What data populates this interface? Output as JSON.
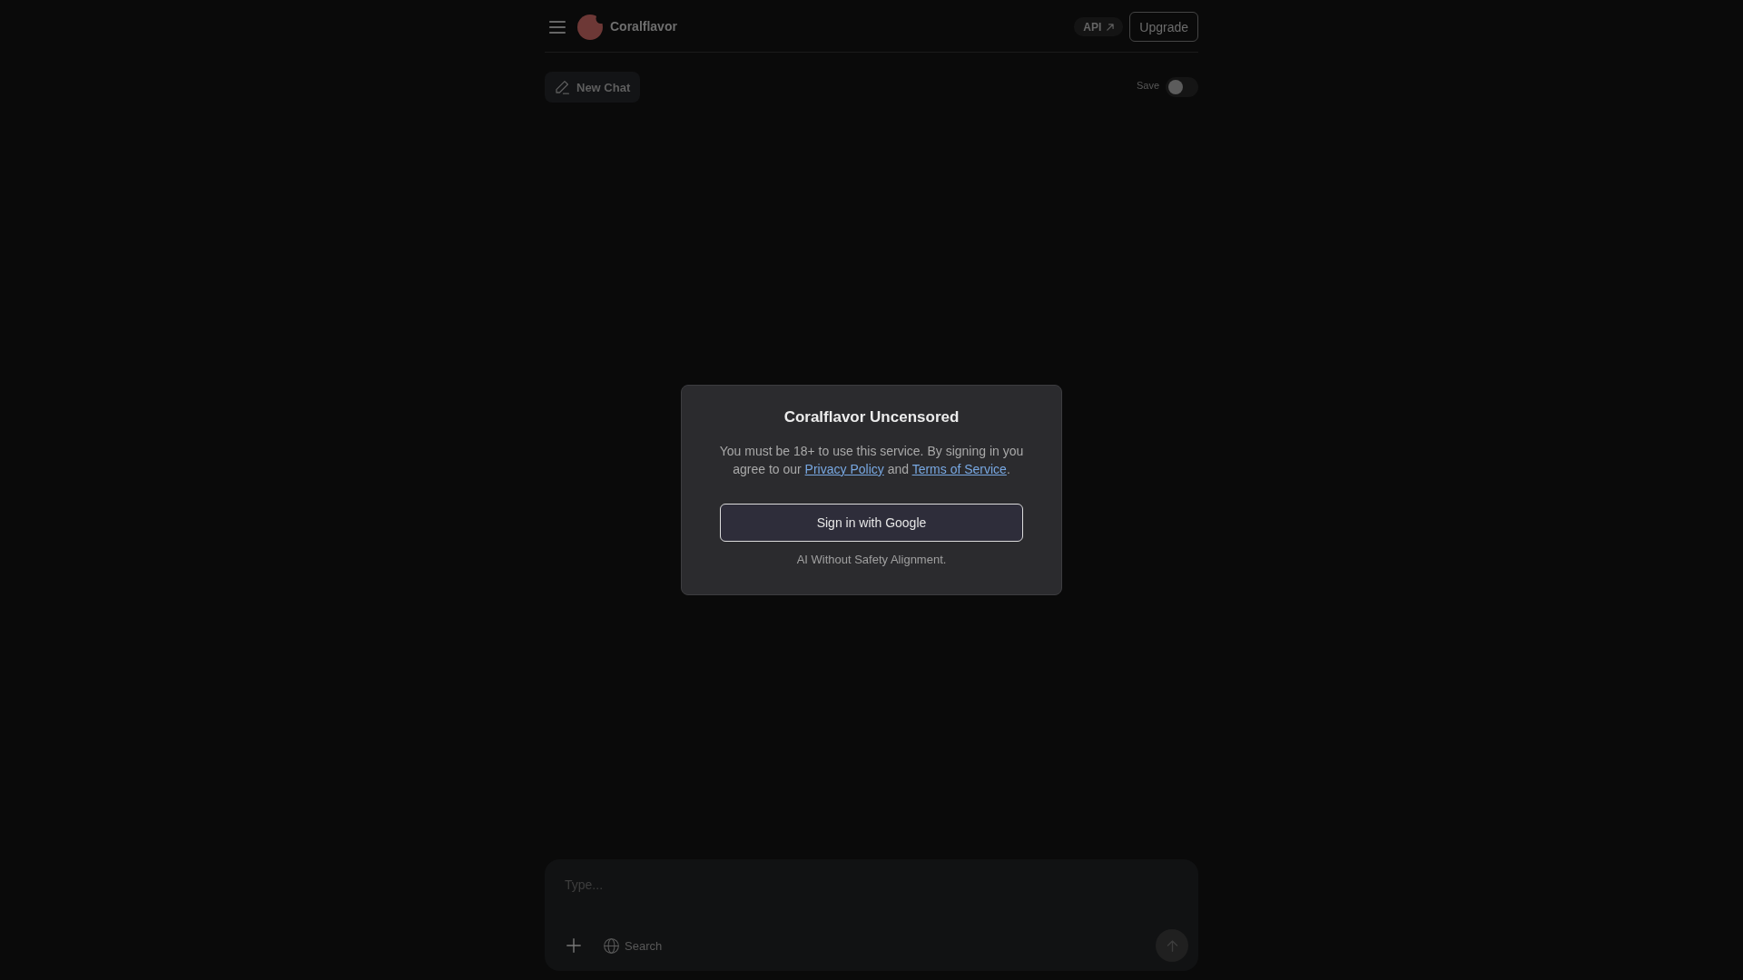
{
  "header": {
    "brand": "Coralflavor",
    "api_link": "API",
    "upgrade_button": "Upgrade"
  },
  "toolbar": {
    "new_chat_button": "New Chat",
    "save_toggle": {
      "label": "Save",
      "on": false
    }
  },
  "dialog": {
    "title": "Coralflavor Uncensored",
    "message": [
      {
        "kind": "text",
        "text": "You must be 18+ to use this service. By signing in you agree to our "
      },
      {
        "kind": "link",
        "text": "Privacy Policy"
      },
      {
        "kind": "text",
        "text": " and "
      },
      {
        "kind": "link",
        "text": "Terms of Service"
      },
      {
        "kind": "text",
        "text": "."
      }
    ],
    "sign_in_button": "Sign in with Google",
    "tagline": "AI Without Safety Alignment."
  },
  "composer": {
    "placeholder": "Type...",
    "search_button": "Search"
  }
}
